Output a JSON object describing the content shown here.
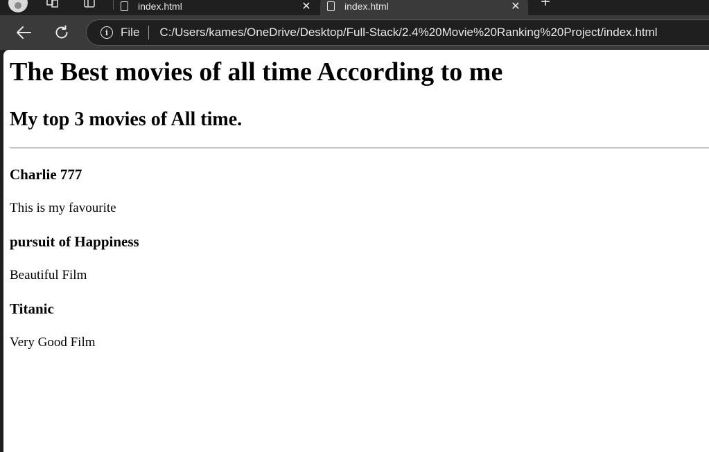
{
  "browser": {
    "tabs": [
      {
        "title": "index.html",
        "close": "✕"
      },
      {
        "title": "index.html",
        "close": "✕"
      }
    ],
    "new_tab": "+",
    "address": {
      "scheme_label": "File",
      "url": "C:/Users/kames/OneDrive/Desktop/Full-Stack/2.4%20Movie%20Ranking%20Project/index.html"
    }
  },
  "page": {
    "heading": "The Best movies of all time According to me",
    "subheading": "My top 3 movies of All time.",
    "movies": [
      {
        "title": "Charlie 777",
        "description": "This is my favourite"
      },
      {
        "title": "pursuit of Happiness",
        "description": "Beautiful Film"
      },
      {
        "title": "Titanic",
        "description": "Very Good Film"
      }
    ]
  },
  "colors": {
    "chrome_dark": "#1f1f1f",
    "toolbar": "#3a3a3a",
    "page_bg": "#ffffff"
  }
}
